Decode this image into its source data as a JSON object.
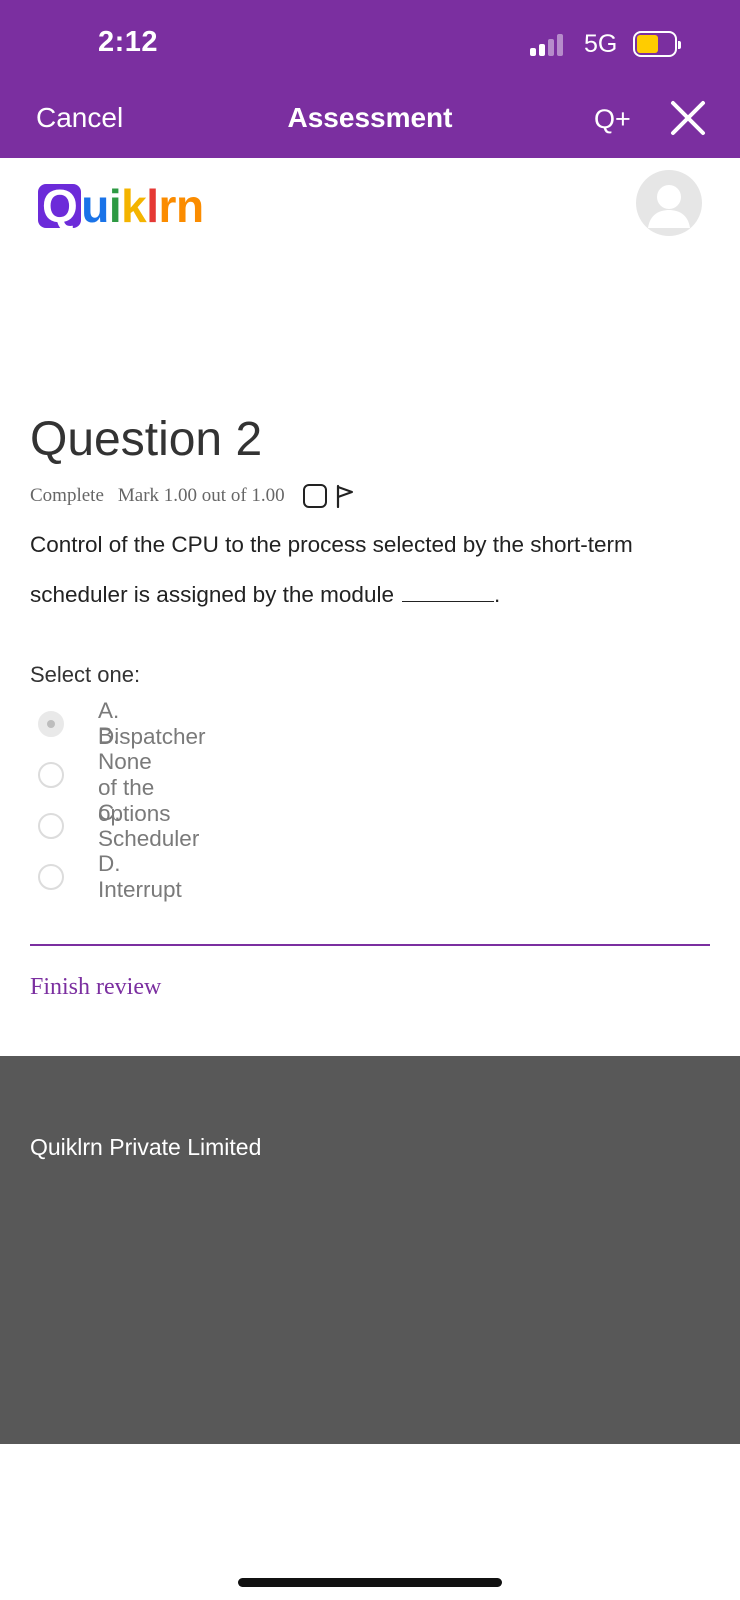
{
  "status_bar": {
    "time": "2:12",
    "network": "5G",
    "battery_color": "#ffcc00"
  },
  "nav": {
    "cancel_label": "Cancel",
    "title": "Assessment",
    "qplus_label": "Q+"
  },
  "logo": {
    "text": "Quiklrn",
    "letters": [
      {
        "ch": "u",
        "color": "#1a73e8"
      },
      {
        "ch": "i",
        "color": "#2e9a43"
      },
      {
        "ch": "k",
        "color": "#f4b400"
      },
      {
        "ch": "l",
        "color": "#e53935"
      },
      {
        "ch": "r",
        "color": "#fb8c00"
      },
      {
        "ch": "n",
        "color": "#fb8c00"
      }
    ],
    "q_letter": "Q"
  },
  "question": {
    "title": "Question 2",
    "state": "Complete",
    "mark": "Mark 1.00 out of 1.00",
    "text": "Control of the CPU to the process selected by the short-term scheduler is assigned by the module",
    "text_end": ".",
    "prompt": "Select one:",
    "options": [
      {
        "label": "A. Dispatcher",
        "selected": true
      },
      {
        "label": "B. None of the options",
        "selected": false
      },
      {
        "label": "C. Scheduler",
        "selected": false
      },
      {
        "label": "D. Interrupt",
        "selected": false
      }
    ]
  },
  "finish_label": "Finish review",
  "footer": {
    "company": "Quiklrn Private Limited"
  },
  "colors": {
    "brand": "#7b2fa0",
    "footer_bg": "#585858"
  }
}
